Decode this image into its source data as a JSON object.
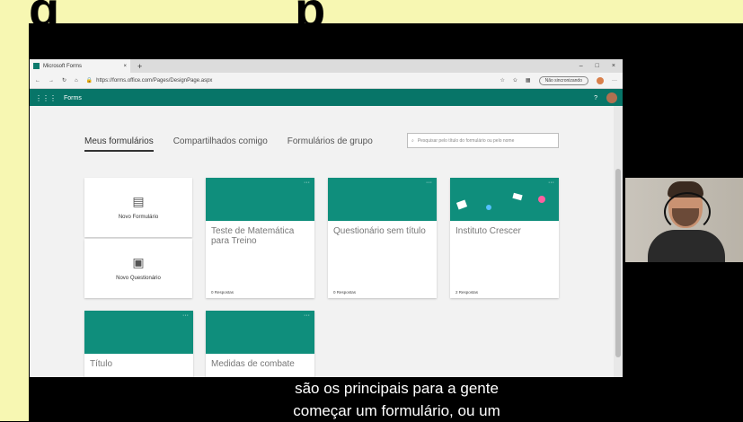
{
  "background": {
    "left_big_text": "g",
    "right_big_text": "p"
  },
  "browser": {
    "tab_title": "Microsoft Forms",
    "tab_close": "×",
    "new_tab": "+",
    "window_controls": [
      "–",
      "□",
      "×"
    ],
    "url": "https://forms.office.com/Pages/DesignPage.aspx",
    "sync_status": "Não sincronizando",
    "more": "···"
  },
  "app_header": {
    "app_name": "Forms",
    "help": "?"
  },
  "tabs": [
    "Meus formulários",
    "Compartilhados comigo",
    "Formulários de grupo"
  ],
  "search": {
    "placeholder": "Pesquisar pelo título do formulário ou pelo nome"
  },
  "new_items": {
    "form_label": "Novo Formulário",
    "quiz_label": "Novo Questionário"
  },
  "forms": [
    {
      "title": "Teste de Matemática para Treino",
      "responses": "0 Respostas"
    },
    {
      "title": "Questionário sem título",
      "responses": "0 Respostas"
    },
    {
      "title": "Instituto Crescer",
      "responses": "2 Respostas"
    },
    {
      "title": "Título",
      "responses": ""
    },
    {
      "title": "Medidas de combate",
      "responses": ""
    }
  ],
  "card_menu": "···",
  "subtitle": {
    "line1": "são os principais para a gente",
    "line2": "começar um formulário, ou um"
  },
  "colors": {
    "header_teal": "#077568",
    "card_banner": "#0f8e7c",
    "instituto_banner": "#3a3ad0",
    "page_yellow": "#f7f7b2"
  }
}
